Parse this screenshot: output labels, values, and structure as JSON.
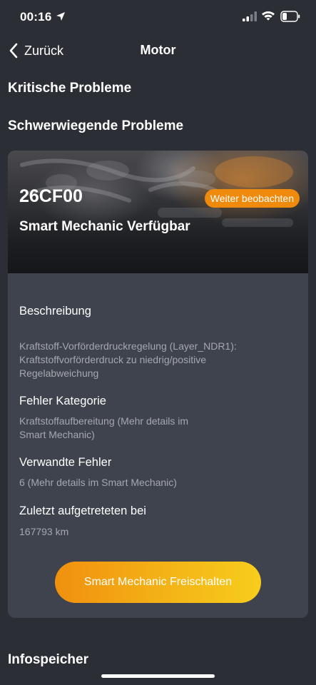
{
  "status_bar": {
    "time": "00:16",
    "icons": [
      "location-arrow-icon",
      "cellular-signal-icon",
      "wifi-icon",
      "battery-icon"
    ]
  },
  "nav": {
    "back_label": "Zurück",
    "title": "Motor"
  },
  "sections": {
    "critical": "Kritische Probleme",
    "severe": "Schwerwiegende Probleme",
    "info_memory": "Infospeicher"
  },
  "fault_card": {
    "code": "26CF00",
    "badge": "Weiter beobachten",
    "subtitle": "Smart Mechanic Verfügbar",
    "description_label": "Beschreibung",
    "description_lines": [
      "Kraftstoff-Vorförderdruckregelung (Layer_NDR1):",
      "Kraftstoffvorförderdruck zu niedrig/positive",
      "Regelabweichung"
    ],
    "category_label": "Fehler Kategorie",
    "category_lines": [
      "Kraftstoffaufbereitung (Mehr details im",
      "Smart Mechanic)"
    ],
    "related_label": "Verwandte Fehler",
    "related_value": "6 (Mehr details im Smart Mechanic)",
    "last_seen_label": "Zuletzt aufgetreteten bei",
    "last_seen_value": "167793 km",
    "unlock_button": "Smart Mechanic Freischalten"
  },
  "colors": {
    "background": "#2b2e35",
    "card": "#3e434d",
    "accent_orange": "#f08a0c",
    "button_gradient_end": "#f7cd1c",
    "secondary_text": "#a5a8ae"
  }
}
